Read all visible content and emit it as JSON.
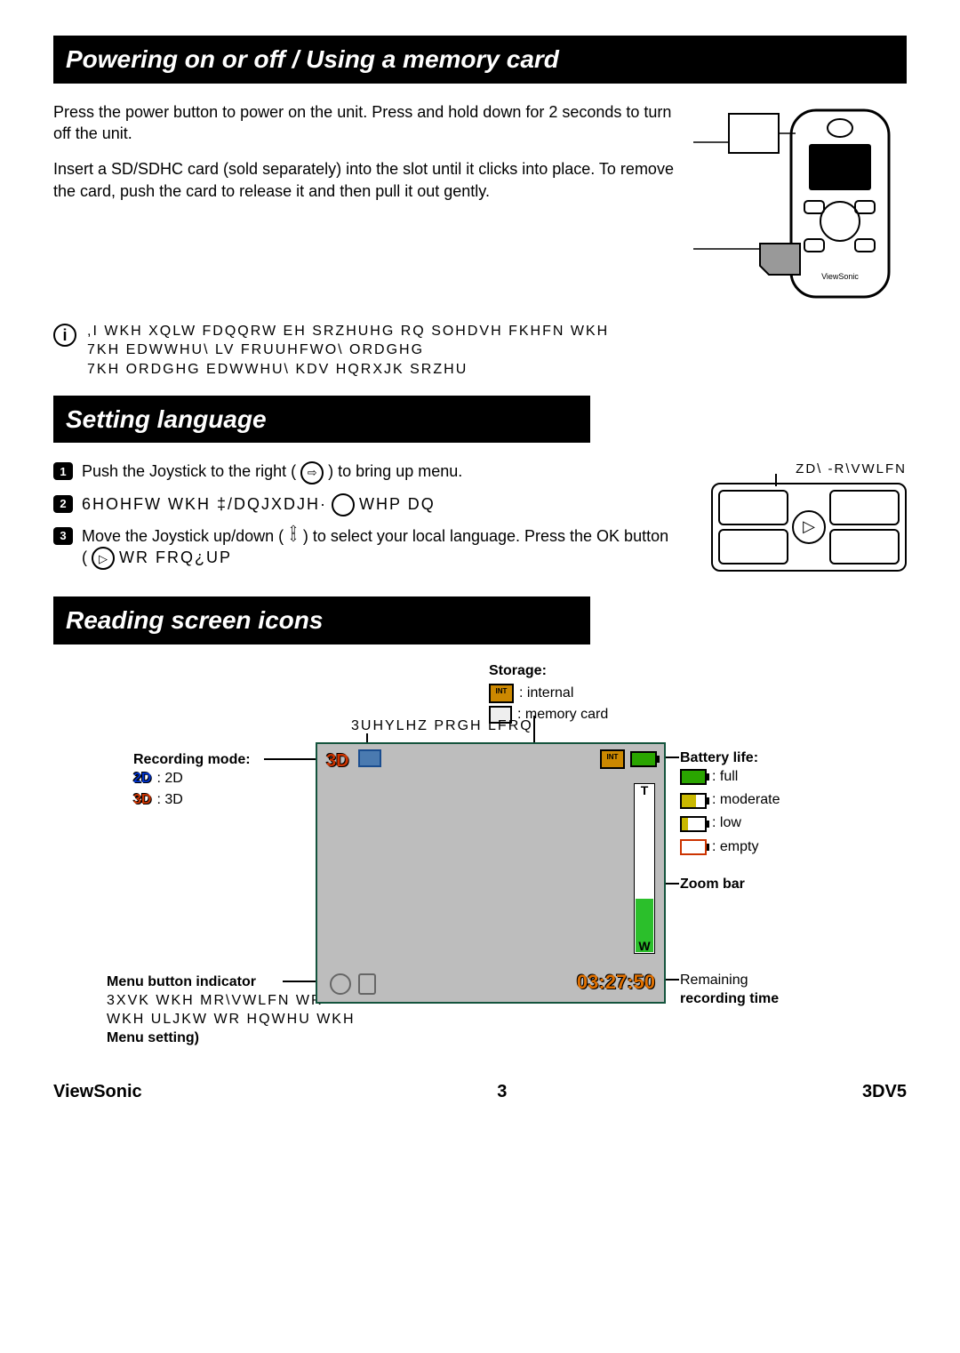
{
  "sections": {
    "powering": "Powering on or off / Using a memory card",
    "language": "Setting language",
    "icons": "Reading screen icons"
  },
  "powering": {
    "p1": "Press the power button to power on the unit. Press and hold down for 2 seconds to turn off the unit.",
    "p2": "Insert a SD/SDHC card (sold separately) into the slot until it clicks into place. To remove the card, push the card to release it and then pull it out gently.",
    "note_line1": ",I WKH XQLW FDQQRW EH SRZHUHG RQ  SOHDVH FKHFN WKH",
    "note_line2": "7KH EDWWHU\\ LV FRUUHFWO\\ ORDGHG",
    "note_line3": "7KH ORDGHG EDWWHU\\ KDV HQRXJK SRZHU"
  },
  "language": {
    "step1": "Push the Joystick to the right (",
    "step1b": ") to bring up menu.",
    "step2": "6HOHFW WKH ‡/DQJXDJH·",
    "step2b": "WHP DQ",
    "step3a": "Move the Joystick up/down (",
    "step3b": ") to select your local language. Press the OK button (",
    "step3c": "   WR FRQ¿UP",
    "joystick_caption": "ZD\\ -R\\VWLFN"
  },
  "icons": {
    "storage_title": "Storage:",
    "storage_internal": ": internal",
    "storage_card": ": memory card",
    "preview_label": "3UHYLHZ PRGH LFRQ",
    "recording_label": "Recording mode:",
    "rec_2d": ": 2D",
    "rec_3d": ": 3D",
    "menu_label": "Menu button indicator",
    "menu_sub1": "3XVK WKH MR\\VWLFN WR",
    "menu_sub2": "WKH ULJKW WR HQWHU WKH",
    "menu_setting": "Menu setting)",
    "battery_label": "Battery life:",
    "batt_full": ": full",
    "batt_mod": ": moderate",
    "batt_low": ": low",
    "batt_empty": ": empty",
    "zoom_label": "Zoom bar",
    "remain_label1": "Remaining",
    "remain_label2": "recording time",
    "rec_time": "03:27:50",
    "T": "T",
    "W": "W"
  },
  "footer": {
    "brand": "ViewSonic",
    "page": "3",
    "model": "3DV5"
  }
}
